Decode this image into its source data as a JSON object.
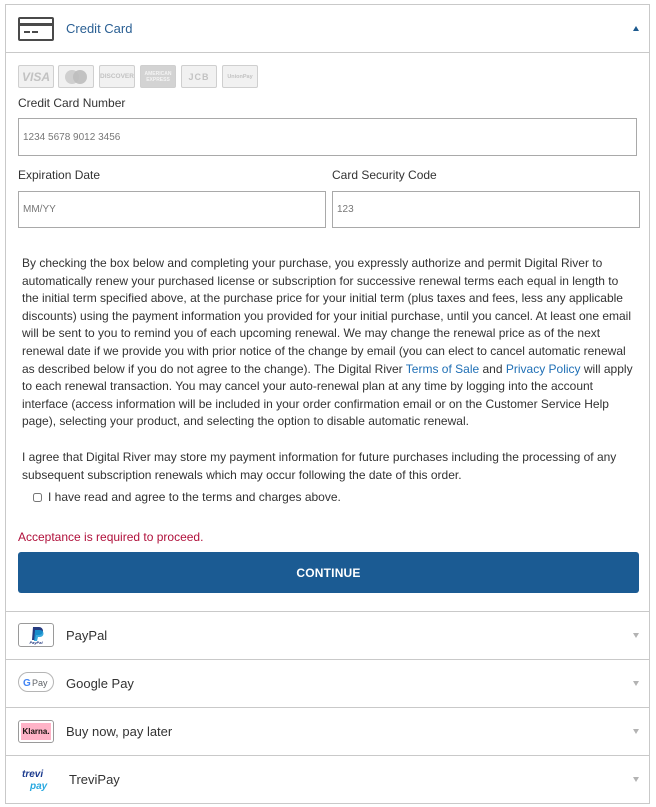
{
  "credit_card": {
    "label": "Credit Card",
    "card_brands": [
      "VISA",
      "Mastercard",
      "DISCOVER",
      "AMERICAN EXPRESS",
      "JCB",
      "UnionPay"
    ],
    "card_number_label": "Credit Card Number",
    "card_number_placeholder": "1234 5678 9012 3456",
    "expiration_label": "Expiration Date",
    "expiration_placeholder": "MM/YY",
    "security_label": "Card Security Code",
    "security_placeholder": "123"
  },
  "legal": {
    "p1_a": "By checking the box below and completing your purchase, you expressly authorize and permit Digital River to automatically renew your purchased license or subscription for successive renewal terms each equal in length to the initial term specified above, at the purchase price for your initial term (plus taxes and fees, less any applicable discounts) using the payment information you provided for your initial purchase, until you cancel. At least one email will be sent to you to remind you of each upcoming renewal. We may change the renewal price as of the next renewal date if we provide you with prior notice of the change by email (you can elect to cancel automatic renewal as described below if you do not agree to the change). The Digital River ",
    "terms_link": "Terms of Sale",
    "and_text": " and ",
    "privacy_link": "Privacy Policy",
    "p1_b": " will apply to each renewal transaction. You may cancel your auto-renewal plan at any time by logging into the account interface (access information will be included in your order confirmation email or on the Customer Service Help page), selecting your product, and selecting the option to disable automatic renewal.",
    "p2": "I agree that Digital River may store my payment information for future purchases including the processing of any subsequent subscription renewals which may occur following the date of this order.",
    "agree_label": "I have read and agree to the terms and charges above."
  },
  "error_message": "Acceptance is required to proceed.",
  "continue_label": "CONTINUE",
  "methods": [
    {
      "label": "PayPal",
      "icon_text": "PayPal"
    },
    {
      "label": "Google Pay",
      "icon_text": "G Pay"
    },
    {
      "label": "Buy now, pay later",
      "icon_text": "Klarna."
    },
    {
      "label": "TreviPay",
      "icon_text": "trevi pay"
    }
  ],
  "colors": {
    "accent": "#1b5b93",
    "link": "#1f6fb5",
    "error": "#b0103b",
    "border": "#c9c9c9"
  }
}
